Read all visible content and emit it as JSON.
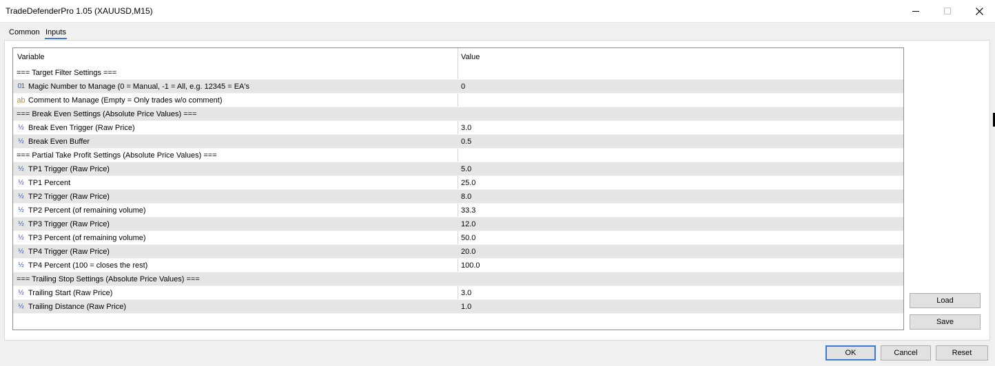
{
  "window": {
    "title": "TradeDefenderPro 1.05 (XAUUSD,M15)"
  },
  "tabs": [
    {
      "label": "Common",
      "active": false
    },
    {
      "label": "Inputs",
      "active": true
    }
  ],
  "grid": {
    "headers": {
      "variable": "Variable",
      "value": "Value"
    },
    "rows": [
      {
        "type": "section",
        "icon": "",
        "variable": "=== Target Filter Settings ===",
        "value": ""
      },
      {
        "type": "int",
        "icon": "01",
        "variable": "Magic Number to Manage (0 = Manual, -1 = All, e.g. 12345 = EA's",
        "value": "0"
      },
      {
        "type": "string",
        "icon": "ab",
        "variable": "Comment to Manage (Empty = Only trades w/o comment)",
        "value": ""
      },
      {
        "type": "section",
        "icon": "",
        "variable": "=== Break Even Settings (Absolute Price Values) ===",
        "value": ""
      },
      {
        "type": "double",
        "icon": "½",
        "variable": "Break Even Trigger (Raw Price)",
        "value": "3.0"
      },
      {
        "type": "double",
        "icon": "½",
        "variable": "Break Even Buffer",
        "value": "0.5"
      },
      {
        "type": "section",
        "icon": "",
        "variable": "=== Partial Take Profit Settings (Absolute Price Values) ===",
        "value": ""
      },
      {
        "type": "double",
        "icon": "½",
        "variable": "TP1 Trigger (Raw Price)",
        "value": "5.0"
      },
      {
        "type": "double",
        "icon": "½",
        "variable": "TP1 Percent",
        "value": "25.0"
      },
      {
        "type": "double",
        "icon": "½",
        "variable": "TP2 Trigger (Raw Price)",
        "value": "8.0"
      },
      {
        "type": "double",
        "icon": "½",
        "variable": "TP2 Percent (of remaining volume)",
        "value": "33.3"
      },
      {
        "type": "double",
        "icon": "½",
        "variable": "TP3 Trigger (Raw Price)",
        "value": "12.0"
      },
      {
        "type": "double",
        "icon": "½",
        "variable": "TP3 Percent (of remaining volume)",
        "value": "50.0"
      },
      {
        "type": "double",
        "icon": "½",
        "variable": "TP4 Trigger (Raw Price)",
        "value": "20.0"
      },
      {
        "type": "double",
        "icon": "½",
        "variable": "TP4 Percent (100 = closes the rest)",
        "value": "100.0"
      },
      {
        "type": "section",
        "icon": "",
        "variable": "=== Trailing Stop Settings (Absolute Price Values) ===",
        "value": ""
      },
      {
        "type": "double",
        "icon": "½",
        "variable": "Trailing Start (Raw Price)",
        "value": "3.0"
      },
      {
        "type": "double",
        "icon": "½",
        "variable": "Trailing Distance (Raw Price)",
        "value": "1.0"
      }
    ]
  },
  "buttons": {
    "load": "Load",
    "save": "Save",
    "ok": "OK",
    "cancel": "Cancel",
    "reset": "Reset"
  },
  "colors": {
    "row_alt": "#e5e5e5",
    "ok_border": "#3a7ad6",
    "icon_blue": "#2e58a8",
    "icon_string": "#c38a28"
  }
}
